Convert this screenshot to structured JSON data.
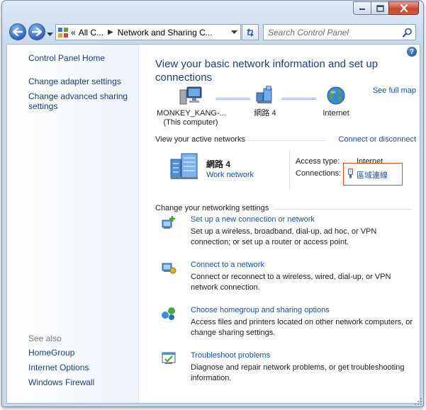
{
  "address": {
    "crumbs": [
      "«",
      "All C...",
      "Network and Sharing C..."
    ]
  },
  "search": {
    "placeholder": "Search Control Panel"
  },
  "sidebar": {
    "home": "Control Panel Home",
    "tasks": [
      "Change adapter settings",
      "Change advanced sharing settings"
    ],
    "see_also_label": "See also",
    "see_also": [
      "HomeGroup",
      "Internet Options",
      "Windows Firewall"
    ]
  },
  "main": {
    "title": "View your basic network information and set up connections",
    "map": {
      "see_full_map": "See full map",
      "computer_name": "MONKEY_KANG-...",
      "computer_sub": "(This computer)",
      "network_name": "網路 4",
      "internet": "Internet"
    },
    "active": {
      "heading": "View your active networks",
      "connect_link": "Connect or disconnect",
      "network_name": "網路  4",
      "network_type": "Work network",
      "access_type_label": "Access type:",
      "access_type_value": "Internet",
      "connections_label": "Connections:",
      "connections_value": "區域連線"
    },
    "settings": {
      "heading": "Change your networking settings",
      "items": [
        {
          "title": "Set up a new connection or network",
          "desc": "Set up a wireless, broadband, dial-up, ad hoc, or VPN connection; or set up a router or access point."
        },
        {
          "title": "Connect to a network",
          "desc": "Connect or reconnect to a wireless, wired, dial-up, or VPN network connection."
        },
        {
          "title": "Choose homegroup and sharing options",
          "desc": "Access files and printers located on other network computers, or change sharing settings."
        },
        {
          "title": "Troubleshoot problems",
          "desc": "Diagnose and repair network problems, or get troubleshooting information."
        }
      ]
    }
  },
  "colors": {
    "link": "#1a4fa3",
    "title": "#1e3d78",
    "highlight_box": "#e0482a"
  }
}
